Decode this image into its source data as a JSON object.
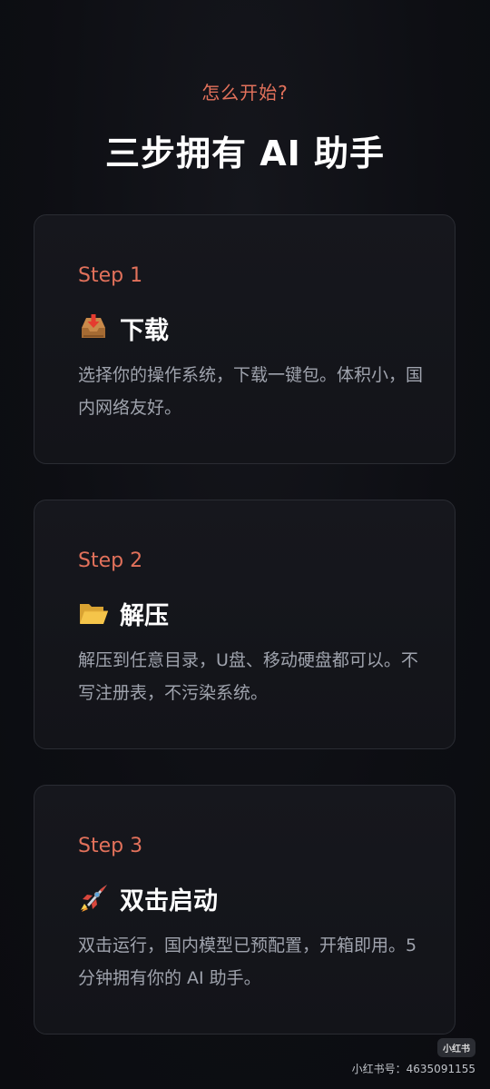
{
  "header": {
    "kicker": "怎么开始?",
    "title": "三步拥有 AI 助手"
  },
  "steps": [
    {
      "step_label": "Step 1",
      "icon": "inbox-tray-icon",
      "heading": "下载",
      "description": "选择你的操作系统，下载一键包。体积小，国内网络友好。"
    },
    {
      "step_label": "Step 2",
      "icon": "open-folder-icon",
      "heading": "解压",
      "description": "解压到任意目录，U盘、移动硬盘都可以。不写注册表，不污染系统。"
    },
    {
      "step_label": "Step 3",
      "icon": "rocket-icon",
      "heading": "双击启动",
      "description": "双击运行，国内模型已预配置，开箱即用。5 分钟拥有你的 AI 助手。"
    }
  ],
  "watermark": {
    "badge": "小红书",
    "user_id": "小红书号：4635091155"
  },
  "colors": {
    "accent": "#e2715b",
    "background": "#0d0e13",
    "card_border": "#2a2c33",
    "body_text": "#9fa3ad"
  }
}
